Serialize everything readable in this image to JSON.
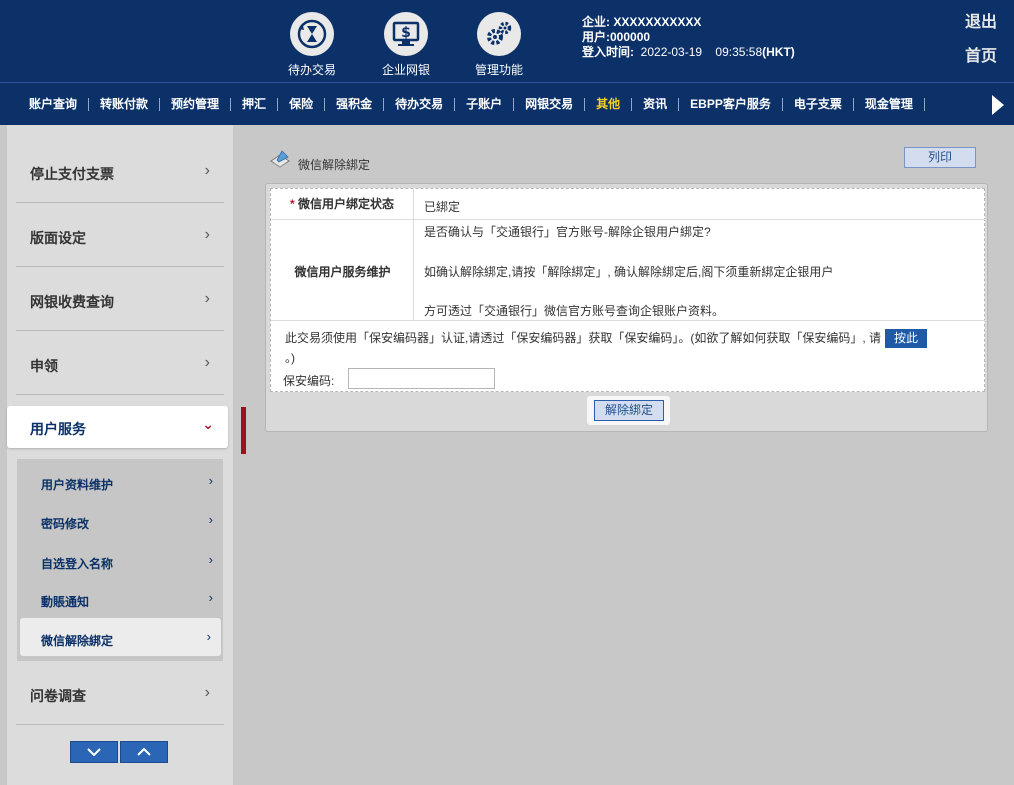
{
  "header": {
    "icons": [
      {
        "label": "待办交易",
        "icon": "hourglass-refresh-icon"
      },
      {
        "label": "企业网银",
        "icon": "monitor-dollar-icon"
      },
      {
        "label": "管理功能",
        "icon": "gears-icon"
      }
    ],
    "company_label": "企业: ",
    "company_value": "XXXXXXXXXXX",
    "user_label": "用户:",
    "user_value": "000000",
    "login_label": "登入时间:",
    "login_date": "2022-03-19",
    "login_time": "09:35:58",
    "login_zone": "(HKT)",
    "logout": "退出",
    "home": "首页"
  },
  "nav": {
    "items": [
      "账户查询",
      "转账付款",
      "预约管理",
      "押汇",
      "保险",
      "强积金",
      "待办交易",
      "子账户",
      "网银交易",
      "其他",
      "资讯",
      "EBPP客户服务",
      "电子支票",
      "现金管理"
    ],
    "active": "其他"
  },
  "sidebar": {
    "items": [
      "停止支付支票",
      "版面设定",
      "网银收费查询",
      "申领"
    ],
    "active": "用户服务",
    "sub_items": [
      "用户资料维护",
      "密码修改",
      "自选登入名称",
      "動賬通知",
      "微信解除綁定"
    ],
    "selected_sub": "微信解除綁定",
    "last_item": "问卷调查"
  },
  "main": {
    "page_title": "微信解除綁定",
    "print_label": "列印",
    "row1_required": "* ",
    "row1_label": "微信用户绑定状态",
    "row1_value": "已綁定",
    "row2_label": "微信用户服务维护",
    "row2_lines": [
      "是否确认与「交通银行」官方账号-解除企银用户綁定?",
      "如确认解除綁定,请按「解除綁定」, 确认解除綁定后,阁下须重新綁定企银用户",
      "方可透过「交通银行」微信官方账号查询企银账户资料。"
    ],
    "note_text": "此交易须使用「保安编码器」认证,请透过「保安编码器」获取「保安编码」。(如欲了解如何获取「保安编码」, 请",
    "note_button": "按此",
    "note_tail": "。)",
    "passcode_label": "保安编码:",
    "passcode_value": "",
    "submit_label": "解除綁定"
  }
}
